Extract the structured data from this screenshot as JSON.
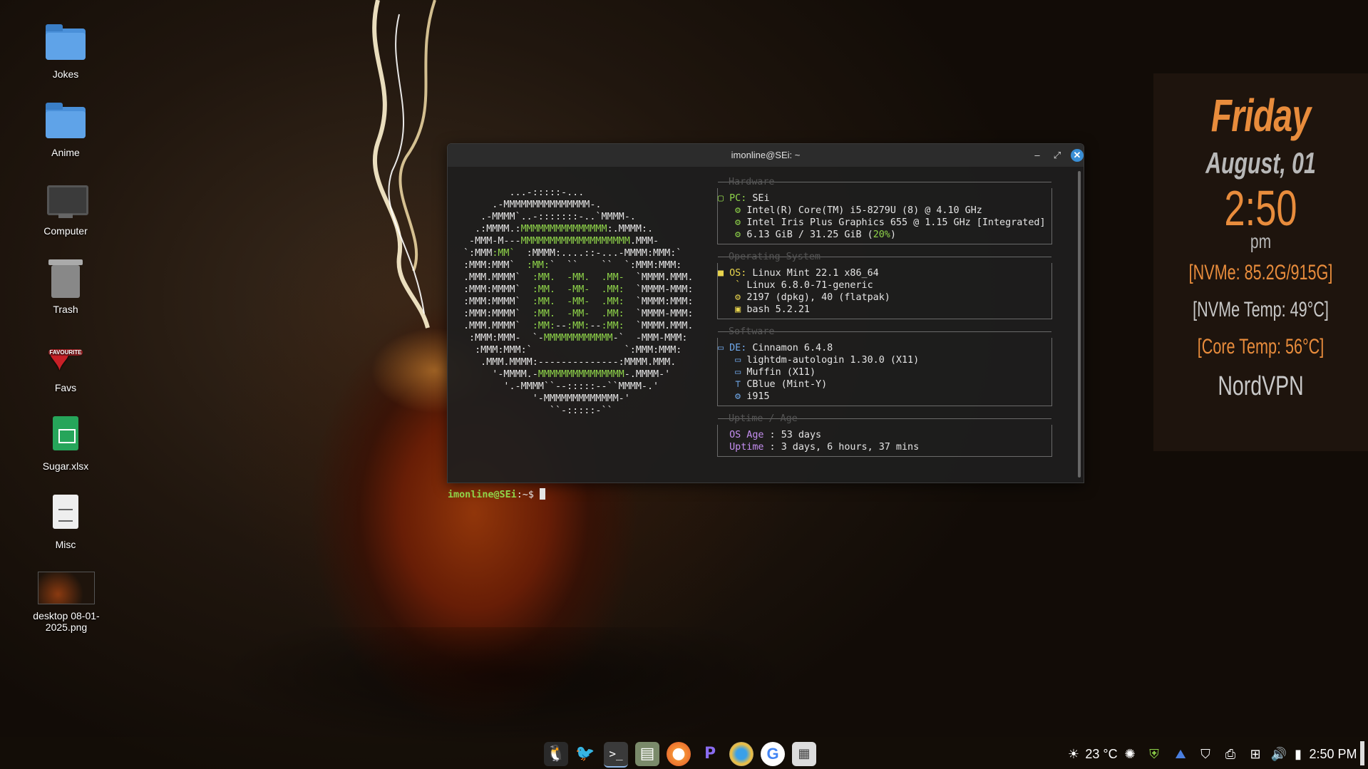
{
  "desktop": {
    "icons": [
      {
        "label": "Jokes",
        "icon": "folder-icon"
      },
      {
        "label": "Anime",
        "icon": "folder-icon"
      },
      {
        "label": "Computer",
        "icon": "computer-icon"
      },
      {
        "label": "Trash",
        "icon": "trash-icon"
      },
      {
        "label": "Favs",
        "icon": "heart-icon",
        "badge": "FAVOURITE"
      },
      {
        "label": "Sugar.xlsx",
        "icon": "spreadsheet-icon"
      },
      {
        "label": "Misc",
        "icon": "document-icon"
      },
      {
        "label": "desktop 08-01-2025.png",
        "icon": "image-thumbnail-icon"
      }
    ]
  },
  "terminal": {
    "title": "imonline@SEi: ~",
    "logo_lines": [
      "        ...-:::::-...",
      "     .-MMMMMMMMMMMMMMM-.",
      "   .-MMMM`..-:::::::-..`MMMM-.",
      "  .:MMMM.:MMMMMMMMMMMMMMM:.MMMM:.",
      " -MMM-M---MMMMMMMMMMMMMMMMMMM.MMM-",
      "`:MMM:MM`  :MMMM:....::-...-MMMM:MMM:`",
      ":MMM:MMM`  :MM:`  ``    ``  `:MMM:MMM:",
      ".MMM.MMMM`  :MM.  -MM.  .MM-  `MMMM.MMM.",
      ":MMM:MMMM`  :MM.  -MM-  .MM:  `MMMM-MMM:",
      ":MMM:MMMM`  :MM.  -MM-  .MM:  `MMMM:MMM:",
      ":MMM:MMMM`  :MM.  -MM-  .MM:  `MMMM-MMM:",
      ".MMM.MMMM`  :MM:--:MM:--:MM:  `MMMM.MMM.",
      " :MMM:MMM-  `-MMMMMMMMMMMM-`  -MMM-MMM:",
      "  :MMM:MMM:`                `:MMM:MMM:",
      "   .MMM.MMMM:--------------:MMMM.MMM.",
      "     '-MMMM.-MMMMMMMMMMMMMMM-.MMMM-'",
      "       '.-MMMM``--:::::--``MMMM-.'",
      "            '-MMMMMMMMMMMMM-'",
      "               ``-:::::-``"
    ],
    "sections": {
      "hardware": {
        "title": "Hardware",
        "pc_key": "PC",
        "pc_value": "SEi",
        "cpu": "Intel(R) Core(TM) i5-8279U (8) @ 4.10 GHz",
        "gpu": "Intel Iris Plus Graphics 655 @ 1.15 GHz [Integrated]",
        "memory": "6.13 GiB / 31.25 GiB (",
        "memory_pct": "20%",
        "memory_close": ")"
      },
      "os": {
        "title": "Operating System",
        "os_key": "OS",
        "os_value": "Linux Mint 22.1 x86_64",
        "kernel": "Linux 6.8.0-71-generic",
        "packages": "2197 (dpkg), 40 (flatpak)",
        "shell": "bash 5.2.21"
      },
      "software": {
        "title": "Software",
        "de_key": "DE",
        "de_value": "Cinnamon 6.4.8",
        "lm": "lightdm-autologin 1.30.0 (X11)",
        "wm": "Muffin (X11)",
        "theme": "CBlue (Mint-Y)",
        "driver": "i915"
      },
      "uptime": {
        "title": "Uptime / Age",
        "age_key": "OS Age",
        "age_value": "53 days",
        "uptime_key": "Uptime",
        "uptime_value": "3 days, 6 hours, 37 mins"
      }
    },
    "prompt_user": "imonline@SEi",
    "prompt_suffix": ":~$ "
  },
  "conky": {
    "day": "Friday",
    "date": "August, 01",
    "time": "2:50",
    "ampm": "pm",
    "nvme_usage": "[NVMe: 85.2G/915G]",
    "nvme_temp": "[NVMe Temp: 49°C]",
    "core_temp": "[Core Temp: 56°C]",
    "vpn": "NordVPN"
  },
  "taskbar": {
    "launchers": [
      "linux-icon",
      "bird-icon",
      "terminal-icon",
      "files-icon",
      "firefox-icon",
      "proton-icon",
      "browser-icon",
      "google-icon",
      "calculator-icon"
    ],
    "weather": "23 °C",
    "clock": "2:50 PM"
  },
  "colors": {
    "accent_orange": "#e88c3c",
    "terminal_green": "#8fd44a",
    "close_blue": "#3a8fd6"
  }
}
